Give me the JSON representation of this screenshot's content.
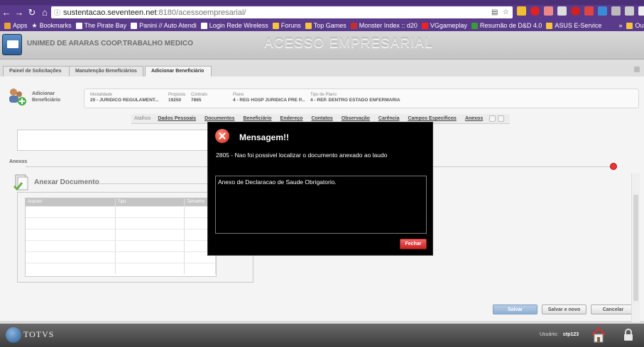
{
  "browser": {
    "url_host": "sustentacao.seventeen.net",
    "url_path": ":8180/acessoempresarial/",
    "bookmarks": [
      {
        "label": "Apps",
        "color": "#e8a23a"
      },
      {
        "label": "Bookmarks",
        "color": "#ffffff"
      },
      {
        "label": "The Pirate Bay",
        "color": "#ffffff"
      },
      {
        "label": "Panini // Auto Atendi",
        "color": "#ffffff"
      },
      {
        "label": "Login Rede Wireless",
        "color": "#ffffff"
      },
      {
        "label": "Foruns",
        "color": "#f5c542"
      },
      {
        "label": "Top Games",
        "color": "#f5c542"
      },
      {
        "label": "Monster Index :: d20",
        "color": "#c03030"
      },
      {
        "label": "VGgameplay",
        "color": "#e22"
      },
      {
        "label": "Resumão de D&D 4.0",
        "color": "#3a9a3a"
      },
      {
        "label": "ASUS E-Service",
        "color": "#f5c542"
      },
      {
        "label": "»",
        "color": ""
      },
      {
        "label": "Outros favoritos",
        "color": "#f5c542"
      }
    ]
  },
  "app": {
    "company": "UNIMED DE ARARAS COOP.TRABALHO MEDICO",
    "title": "ACESSO EMPRESARIAL",
    "tabs": [
      "Painel de Solicitações",
      "Manutenção Beneficiários",
      "Adicionar Beneficiário"
    ],
    "active_tab": 2
  },
  "benef_header": {
    "title_line1": "Adicionar",
    "title_line2": "Beneficiário",
    "modalidade_label": "Modalidade",
    "modalidade_value": "20 - JURIDICO REGULAMENT...",
    "proposta_label": "Proposta",
    "proposta_value": "19250",
    "contrato_label": "Contrato",
    "contrato_value": "7865",
    "plano_label": "Plano",
    "plano_value": "4 - REG HOSP JURIDICA PRE P...",
    "tipo_plano_label": "Tipo de Plano",
    "tipo_plano_value": "4 - REP. DENTRO ESTADO ENFERMARIA"
  },
  "section_nav": {
    "label": "Atalhos",
    "links": [
      "Dados Pessoais",
      "Documentos",
      "Beneficiário",
      "Endereço",
      "Contatos",
      "Observação",
      "Carência",
      "Campos Específicos",
      "Anexos"
    ]
  },
  "anexos": {
    "section_label": "Anexos",
    "title": "Anexar Documento",
    "columns": [
      "Arquivo",
      "Tipo",
      "Tamanho"
    ]
  },
  "actions": {
    "save": "Salvar",
    "save_new": "Salvar e novo",
    "cancel": "Cancelar"
  },
  "footer": {
    "brand": "TOTVS",
    "user_label": "Usuário:",
    "user_value": "ctp123"
  },
  "modal": {
    "title": "Mensagem!!",
    "message": "2805 - Nao foi possivel localizar o documento anexado ao laudo",
    "detail": "Anexo de Declaracao de Saude Obrigatorio.",
    "close_label": "Fechar"
  }
}
